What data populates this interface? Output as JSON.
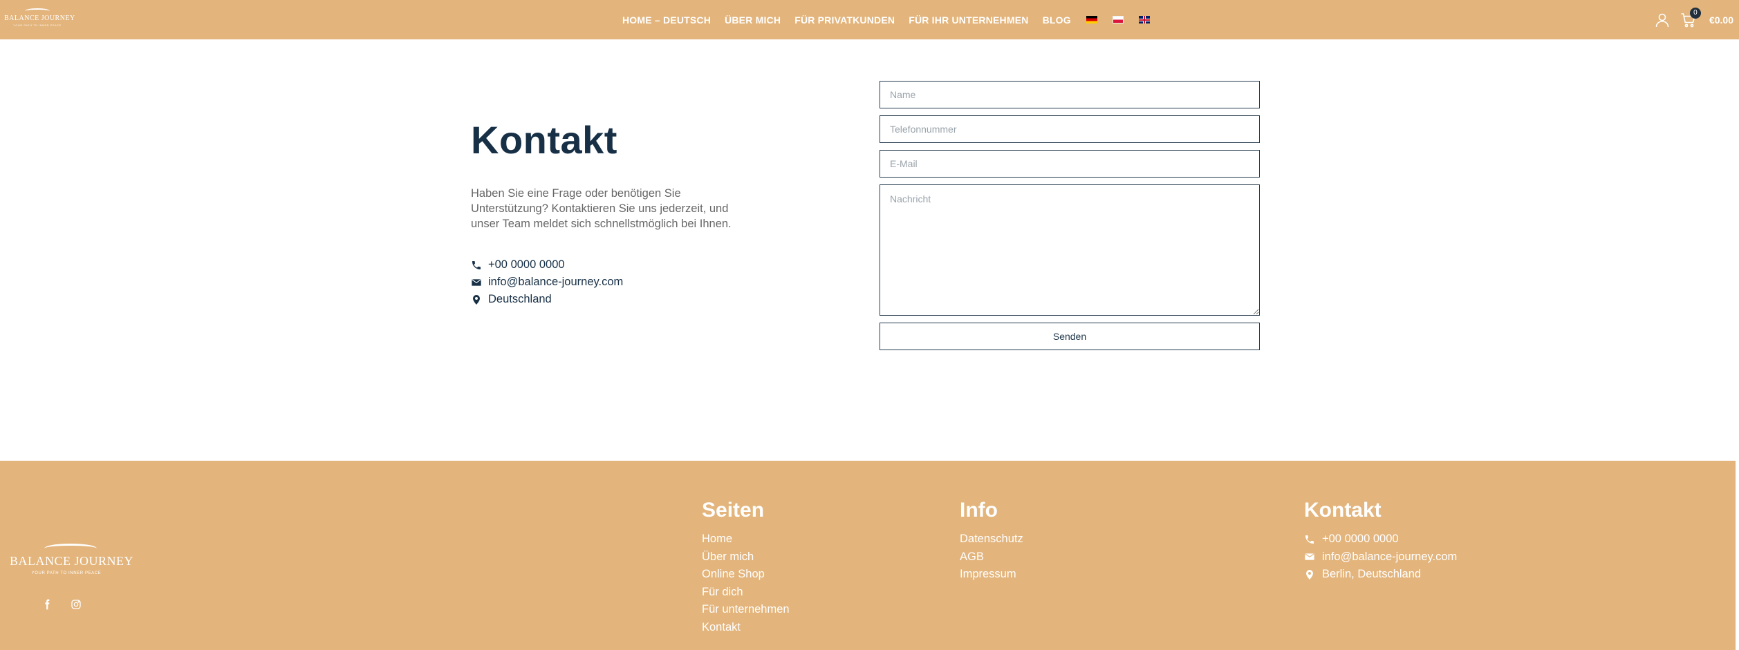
{
  "header": {
    "logo_text": "BALANCE JOURNEY",
    "logo_tagline": "YOUR PATH TO INNER PEACE",
    "nav": [
      {
        "label": "HOME – DEUTSCH"
      },
      {
        "label": "ÜBER MICH"
      },
      {
        "label": "FÜR PRIVATKUNDEN"
      },
      {
        "label": "FÜR IHR UNTERNEHMEN"
      },
      {
        "label": "BLOG"
      }
    ],
    "cart_count": "0",
    "cart_total": "€0.00"
  },
  "contact": {
    "title": "Kontakt",
    "intro": "Haben Sie eine Frage oder benötigen Sie Unterstützung? Kontaktieren Sie uns jederzeit, und unser Team meldet sich schnellstmöglich bei Ihnen.",
    "phone": "+00 0000 0000",
    "email": "info@balance-journey.com",
    "location": "Deutschland"
  },
  "form": {
    "name_placeholder": "Name",
    "phone_placeholder": "Telefonnummer",
    "email_placeholder": "E-Mail",
    "message_placeholder": "Nachricht",
    "submit_label": "Senden"
  },
  "footer": {
    "logo_text": "BALANCE JOURNEY",
    "logo_tagline": "YOUR PATH TO INNER PEACE",
    "pages_title": "Seiten",
    "pages": [
      "Home",
      "Über mich",
      "Online Shop",
      "Für dich",
      "Für unternehmen",
      "Kontakt"
    ],
    "info_title": "Info",
    "info": [
      "Datenschutz",
      "AGB",
      "Impressum"
    ],
    "contact_title": "Kontakt",
    "phone": "+00 0000 0000",
    "email": "info@balance-journey.com",
    "address": "Berlin, Deutschland"
  },
  "colors": {
    "brand": "#e3b47b",
    "text_dark": "#173046",
    "border": "#22384b"
  }
}
